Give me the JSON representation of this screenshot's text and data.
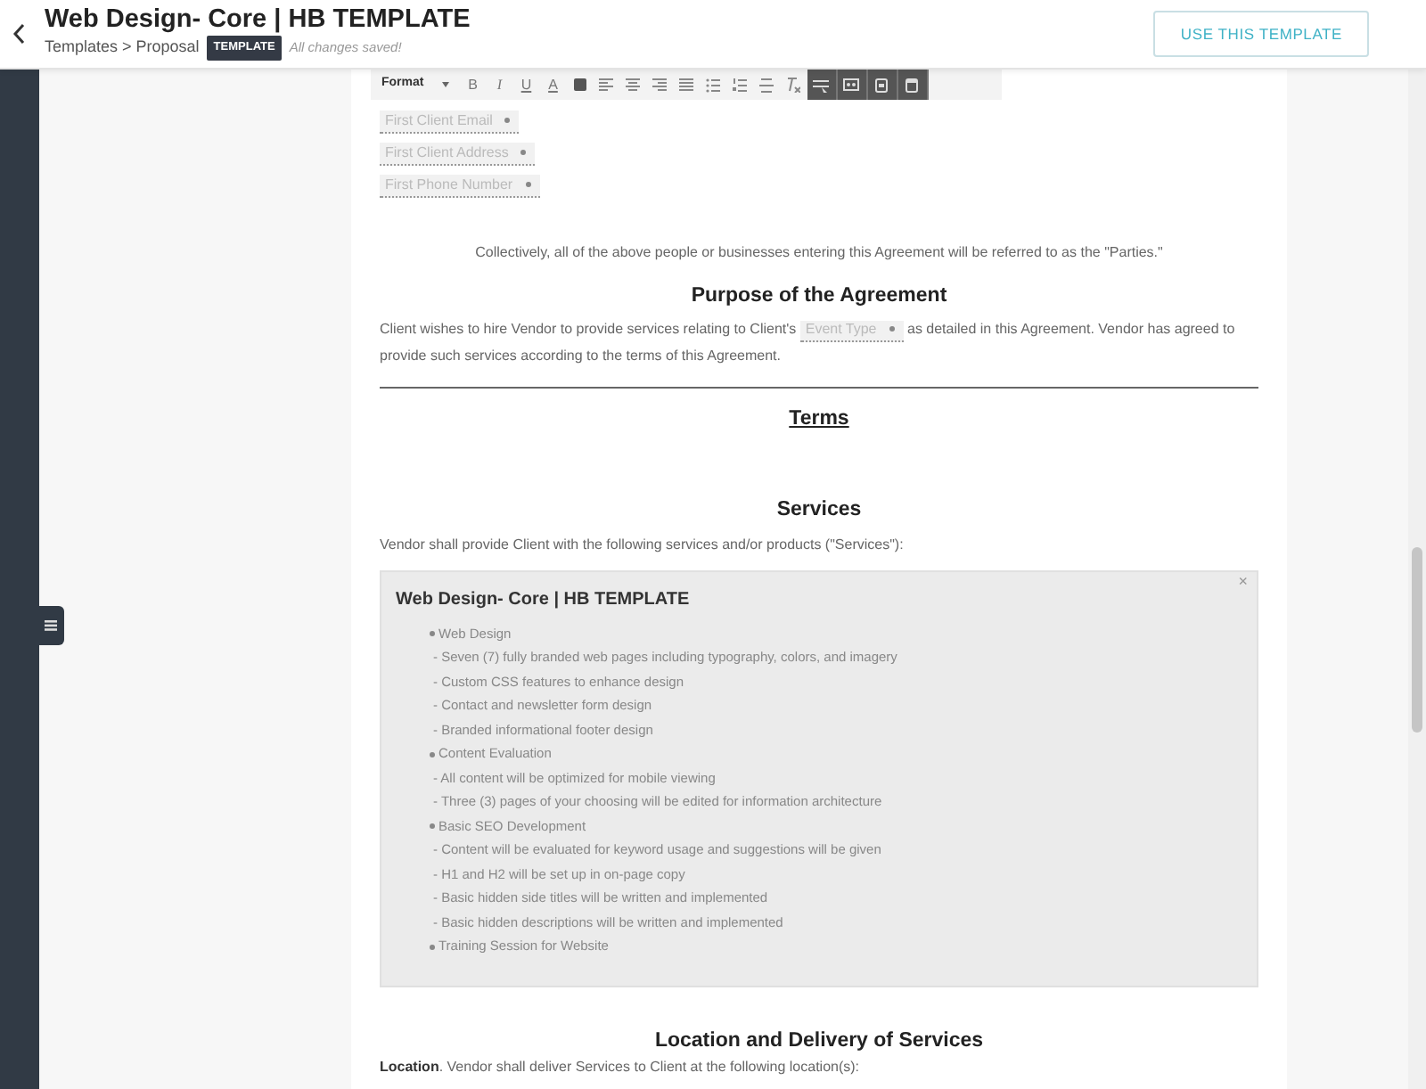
{
  "header": {
    "title": "Web Design- Core | HB TEMPLATE",
    "breadcrumb": "Templates > Proposal",
    "badge": "TEMPLATE",
    "status": "All changes saved!",
    "action_button": "USE THIS TEMPLATE"
  },
  "toolbar": {
    "format": "Format",
    "text_buttons": [
      "B",
      "I",
      "U",
      "A"
    ]
  },
  "field_chips": [
    "First Client Email",
    "First Client Address",
    "First Phone Number"
  ],
  "parties_note": "Collectively, all of the above people or businesses entering this Agreement will be referred to as the \"Parties.\"",
  "purpose": {
    "heading": "Purpose of the Agreement",
    "text_before": "Client wishes to hire Vendor to provide services relating to Client's",
    "chip": "Event Type",
    "text_after": "as detailed in this Agreement. Vendor has agreed to provide such services according to the terms of this Agreement."
  },
  "terms_heading": "Terms",
  "services": {
    "heading": "Services",
    "intro": "Vendor shall provide Client with the following services and/or products (\"Services\"):",
    "package": {
      "title": "Web Design- Core | HB TEMPLATE",
      "close": "×",
      "items": [
        {
          "label": "Web Design",
          "children": [
            "- Seven (7) fully branded web pages including typography, colors, and imagery",
            "- Custom CSS features to enhance design",
            "- Contact and newsletter form design",
            "- Branded informational footer design"
          ]
        },
        {
          "label": "Content Evaluation",
          "children": [
            "- All content will be optimized for mobile viewing",
            "- Three (3) pages of your choosing will be edited for information architecture"
          ]
        },
        {
          "label": "Basic SEO Development",
          "children": [
            "- Content will be evaluated for keyword usage and suggestions will be given",
            "- H1 and H2 will be set up in on-page copy",
            "- Basic hidden side titles will be written and implemented",
            "- Basic hidden descriptions will be written and implemented"
          ]
        },
        {
          "label": "Training Session for Website"
        }
      ]
    }
  },
  "location": {
    "heading": "Location and Delivery of Services",
    "text": "**Location**. Vendor shall deliver Services to Client at the following location(s):"
  }
}
